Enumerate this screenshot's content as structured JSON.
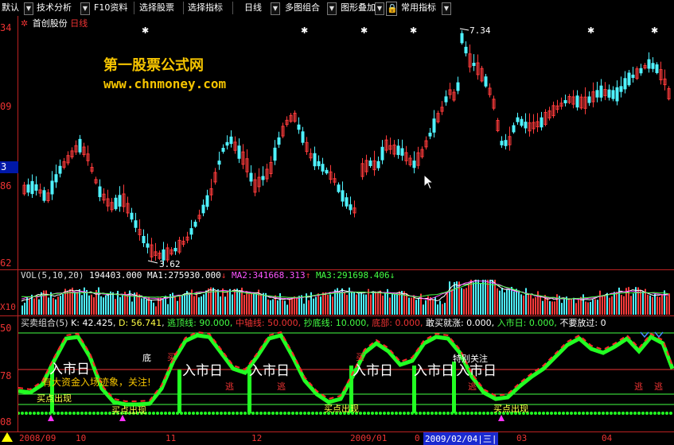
{
  "toolbar": {
    "items": [
      "默认",
      "技术分析",
      "F10资料",
      "选择股票",
      "选择指标",
      "日线",
      "多图组合",
      "图形叠加",
      "常用指标"
    ]
  },
  "stock": {
    "name": "首创股份",
    "period": "日线"
  },
  "watermark": {
    "line1": "第一股票公式网",
    "line2": "www.chnmoney.com"
  },
  "price_axis": {
    "labels": [
      "34",
      "09",
      "3",
      "86",
      "62"
    ]
  },
  "annotations": {
    "high": "7.34",
    "low": "3.62"
  },
  "volume": {
    "label": "VOL(5,10,20)",
    "value": "194403.000",
    "ma1_label": "MA1:",
    "ma1": "275930.000",
    "ma2_label": "MA2:",
    "ma2": "341668.313",
    "ma3_label": "MA3:",
    "ma3": "291698.406",
    "axis_label": "X10"
  },
  "indicator": {
    "title": "买卖组合(5)",
    "k": "K: 42.425",
    "d": "D: 56.741",
    "top_line": "逃顶线: 90.000,",
    "mid_line": "中轴线: 50.000,",
    "bottom_line": "抄底线: 10.000,",
    "bottom": "底部: 0.000,",
    "dare_buy": "敢买就涨: 0.000,",
    "enter": "入市日: 0.000,",
    "dont_miss": "不要放过: 0",
    "axis_labels": [
      "50",
      "78",
      "08"
    ],
    "texts": {
      "enter_day": "入市日",
      "escape": "逃",
      "big_funds": "有大资金入场迹象，关注!",
      "buy_point": "买点出现",
      "special": "特别关注",
      "bottom_char": "底",
      "buy_char": "买"
    }
  },
  "date_axis": {
    "labels": [
      "2008/09",
      "10",
      "11",
      "12",
      "2009/01",
      "0",
      "2009/02/04|三|",
      "03",
      "04"
    ]
  },
  "colors": {
    "up": "#ff3b3b",
    "down": "#4ff2ff",
    "k": "#ff2a2a",
    "d": "#22ff22",
    "ma1": "#ffffff",
    "ma2": "#ff55ff",
    "ma3": "#44ff44"
  }
}
